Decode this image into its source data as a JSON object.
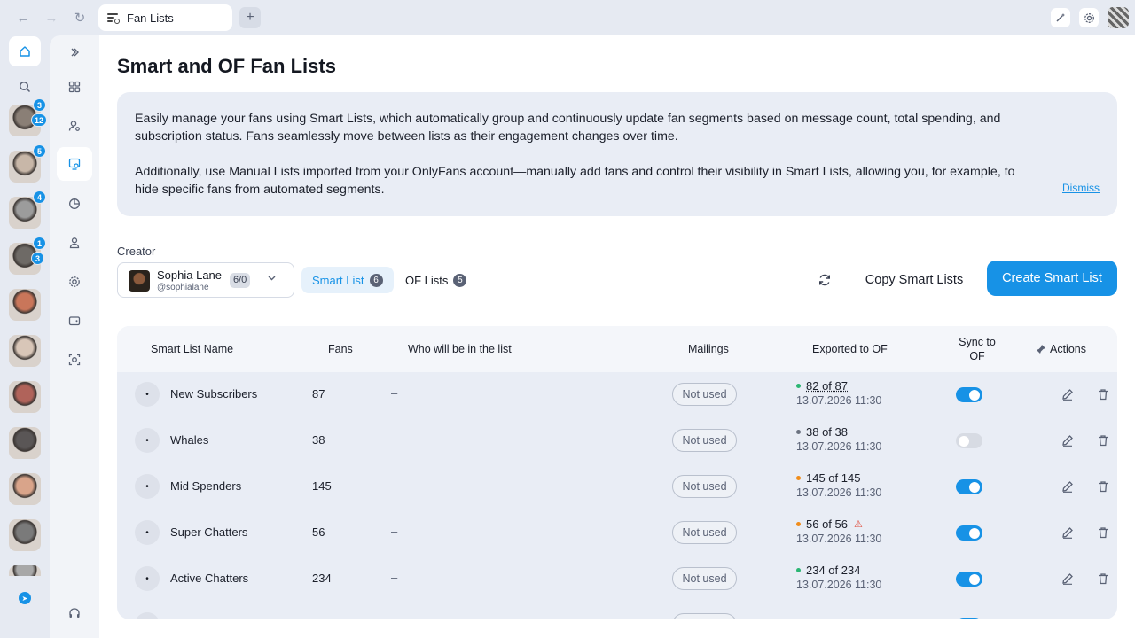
{
  "browser": {
    "tab_title": "Fan Lists",
    "new_tab": "+",
    "back": "←",
    "forward": "→",
    "reload": "↻"
  },
  "rail": {
    "creators": [
      {
        "color": "#8a7f76",
        "badges": [
          "3",
          "12"
        ]
      },
      {
        "color": "#c8b7a8",
        "badges": [
          "5"
        ]
      },
      {
        "color": "#9c9c9c",
        "badges": [
          "4"
        ]
      },
      {
        "color": "#6e6a66",
        "badges": [
          "1",
          "3"
        ]
      },
      {
        "color": "#c9765a",
        "badges": []
      },
      {
        "color": "#d8c6b8",
        "badges": []
      },
      {
        "color": "#b0635a",
        "badges": []
      },
      {
        "color": "#5a5656",
        "badges": []
      },
      {
        "color": "#d9a48a",
        "badges": []
      },
      {
        "color": "#7a7a7a",
        "badges": []
      },
      {
        "color": "#a8a8a8",
        "badges": []
      }
    ]
  },
  "page": {
    "title": "Smart and OF Fan Lists",
    "info_p1": "Easily manage your fans using Smart Lists, which automatically group and continuously update fan segments based on message count, total spending, and subscription status. Fans seamlessly move between lists as their engagement changes over time.",
    "info_p2": "Additionally, use Manual Lists imported from your OnlyFans account—manually add fans and control their visibility in Smart Lists, allowing you, for example, to hide specific fans from automated segments.",
    "dismiss": "Dismiss"
  },
  "controls": {
    "creator_label": "Creator",
    "creator_name": "Sophia Lane",
    "creator_handle": "@sophialane",
    "creator_count": "6/0",
    "smart_list_label": "Smart List",
    "smart_list_count": "6",
    "of_lists_label": "OF Lists",
    "of_lists_count": "5",
    "copy_label": "Copy Smart Lists",
    "create_label": "Create Smart List"
  },
  "table": {
    "columns": {
      "name": "Smart List Name",
      "fans": "Fans",
      "who": "Who will be in the list",
      "mailings": "Mailings",
      "exported": "Exported to OF",
      "sync": "Sync to OF",
      "actions": "Actions"
    },
    "rows": [
      {
        "name": "New Subscribers",
        "fans": "87",
        "who": "–",
        "mailings": "Not used",
        "exported": "82 of 87",
        "date": "13.07.2026 11:30",
        "dot": "#2bb673",
        "sync": true,
        "warn": false
      },
      {
        "name": "Whales",
        "fans": "38",
        "who": "–",
        "mailings": "Not used",
        "exported": "38 of 38",
        "date": "13.07.2026 11:30",
        "dot": "#6b7280",
        "sync": false,
        "warn": false
      },
      {
        "name": "Mid Spenders",
        "fans": "145",
        "who": "–",
        "mailings": "Not used",
        "exported": "145 of 145",
        "date": "13.07.2026 11:30",
        "dot": "#f08c1a",
        "sync": true,
        "warn": false
      },
      {
        "name": "Super Chatters",
        "fans": "56",
        "who": "–",
        "mailings": "Not used",
        "exported": "56 of 56",
        "date": "13.07.2026 11:30",
        "dot": "#f08c1a",
        "sync": true,
        "warn": true
      },
      {
        "name": "Active Chatters",
        "fans": "234",
        "who": "–",
        "mailings": "Not used",
        "exported": "234 of 234",
        "date": "13.07.2026 11:30",
        "dot": "#2bb673",
        "sync": true,
        "warn": false
      }
    ],
    "drag_glyph": "•",
    "warn_glyph": "⚠"
  },
  "colors": {
    "accent": "#1792e6",
    "info_bg": "#e9edf5"
  }
}
